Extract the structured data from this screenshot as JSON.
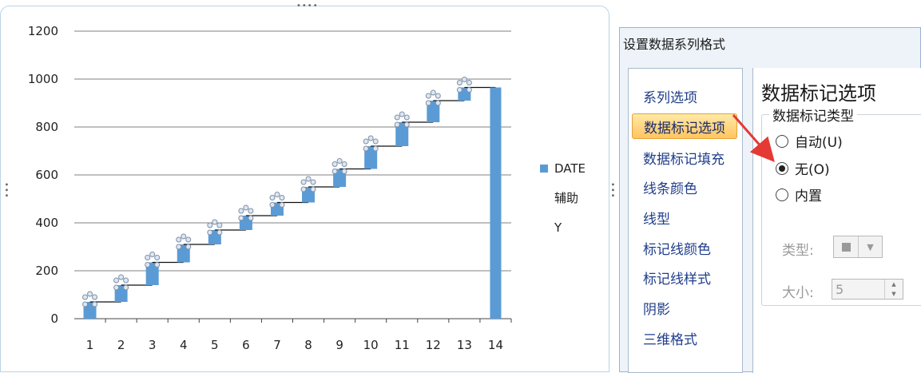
{
  "chart_data": {
    "type": "bar",
    "categories": [
      "1",
      "2",
      "3",
      "4",
      "5",
      "6",
      "7",
      "8",
      "9",
      "10",
      "11",
      "12",
      "13",
      "14"
    ],
    "series": [
      {
        "name": "DATE",
        "values": [
          60,
          125,
          190,
          255,
          320,
          380,
          440,
          500,
          565,
          630,
          695,
          760,
          825,
          965
        ],
        "color": "#5b9bd5"
      },
      {
        "name": "辅助",
        "values": [
          0,
          70,
          140,
          235,
          310,
          370,
          430,
          485,
          550,
          625,
          720,
          820,
          910,
          0
        ]
      },
      {
        "name": "Y",
        "values": [
          70,
          140,
          235,
          310,
          370,
          430,
          485,
          550,
          625,
          720,
          820,
          910,
          965,
          null
        ]
      }
    ],
    "yticks": [
      "1200",
      "1000",
      "800",
      "600",
      "400",
      "200",
      "0"
    ],
    "ylim": [
      0,
      1200
    ],
    "legend": "right",
    "grid": true
  },
  "dialog": {
    "title": "设置数据系列格式",
    "nav_items": [
      "系列选项",
      "数据标记选项",
      "数据标记填充",
      "线条颜色",
      "线型",
      "标记线颜色",
      "标记线样式",
      "阴影",
      "三维格式"
    ],
    "selected_index": 1,
    "panel_title": "数据标记选项",
    "group_label": "数据标记类型",
    "radio_auto": "自动(U)",
    "radio_none": "无(O)",
    "radio_builtin": "内置",
    "selected_radio": "none",
    "type_label": "类型:",
    "size_label": "大小:",
    "size_value": "5"
  },
  "colors": {
    "accent": "#5b9bd5",
    "arrow": "#e53935",
    "nav_text": "#1f3d8a"
  }
}
